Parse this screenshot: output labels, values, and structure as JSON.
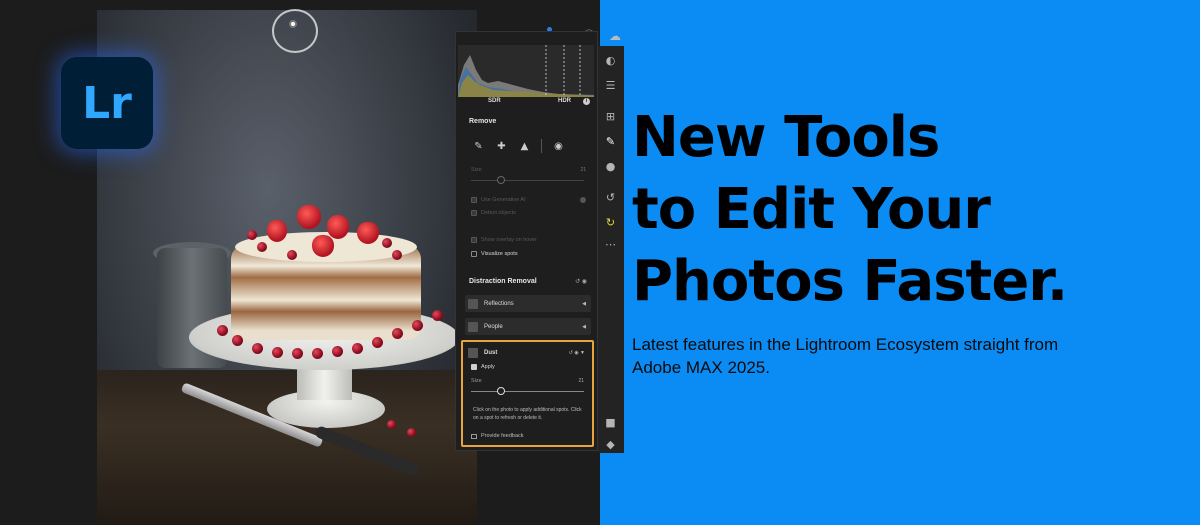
{
  "colors": {
    "background": "#0b8cf5",
    "accent_orange": "#e8a33a",
    "lr_blue": "#31a8ff",
    "lr_dark": "#001e36"
  },
  "logo": {
    "text": "Lr",
    "icon": "lightroom-logo-icon"
  },
  "top_toolbar": {
    "icons": [
      "bell-icon",
      "share-icon",
      "help-icon",
      "cloud-icon"
    ]
  },
  "histogram": {
    "sdr_label": "SDR",
    "hdr_label": "HDR"
  },
  "remove_panel": {
    "title": "Remove",
    "tools": [
      "eraser-icon",
      "heal-icon",
      "clone-stamp-icon",
      "visualize-eye-icon"
    ],
    "size_label": "Size",
    "size_value": "21",
    "use_generative_ai": "Use Generative AI",
    "detect_objects": "Detect objects",
    "show_overlay": "Show overlay on hover",
    "visualize_spots": "Visualize spots"
  },
  "distraction_removal": {
    "title": "Distraction Removal",
    "items": [
      {
        "label": "Reflections",
        "icon": "reflections-icon"
      },
      {
        "label": "People",
        "icon": "people-icon"
      }
    ],
    "dust": {
      "label": "Dust",
      "apply_label": "Apply",
      "size_label": "Size",
      "size_value": "21",
      "hint": "Click on the photo to apply additional spots. Click on a spot to refresh or delete it.",
      "feedback": "Provide feedback"
    }
  },
  "side_tools": [
    "presets-icon",
    "sliders-icon",
    "crop-icon",
    "remove-brush-icon",
    "mask-icon",
    "history-icon",
    "sync-icon",
    "more-icon",
    "comment-icon",
    "tag-icon"
  ],
  "headline": {
    "line1": "New Tools",
    "line2": "to Edit Your",
    "line3": "Photos Faster.",
    "subline": "Latest features in the Lightroom Ecosystem straight from Adobe MAX 2025."
  }
}
